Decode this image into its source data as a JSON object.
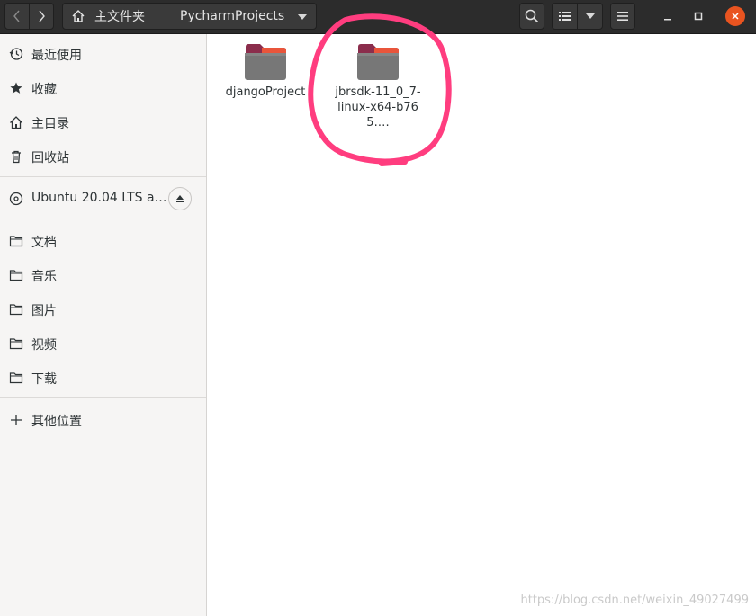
{
  "header": {
    "nav_back_icon": "chevron-left-icon",
    "nav_forward_icon": "chevron-right-icon",
    "home_label": "主文件夹",
    "current_folder": "PycharmProjects",
    "search_icon": "search-icon",
    "view_icon": "list-view-icon",
    "menu_icon": "hamburger-menu-icon",
    "accent_close": "#e95420"
  },
  "sidebar": {
    "items": [
      {
        "label": "最近使用",
        "icon": "clock-icon"
      },
      {
        "label": "收藏",
        "icon": "star-icon"
      },
      {
        "label": "主目录",
        "icon": "home-icon"
      },
      {
        "label": "回收站",
        "icon": "trash-icon"
      },
      {
        "label": "Ubuntu 20.04 LTS a…",
        "icon": "disc-icon",
        "action_icon": "eject-icon"
      },
      {
        "label": "文档",
        "icon": "folder-icon"
      },
      {
        "label": "音乐",
        "icon": "folder-icon"
      },
      {
        "label": "图片",
        "icon": "folder-icon"
      },
      {
        "label": "视频",
        "icon": "folder-icon"
      },
      {
        "label": "下载",
        "icon": "folder-icon"
      },
      {
        "label": "其他位置",
        "icon": "plus-icon"
      }
    ]
  },
  "files": [
    {
      "name": "djangoProject",
      "icon": "folder-icon"
    },
    {
      "name": "jbrsdk-11_0_7-linux-x64-b765.…",
      "icon": "folder-icon"
    }
  ],
  "watermark": "https://blog.csdn.net/weixin_49027499",
  "colors": {
    "header_bg": "#2c2c2c",
    "sidebar_bg": "#f6f5f4",
    "folder_body": "#7a7a7a",
    "folder_tab": "#8c2a4a",
    "annotation_ring": "#ff3d7f"
  }
}
